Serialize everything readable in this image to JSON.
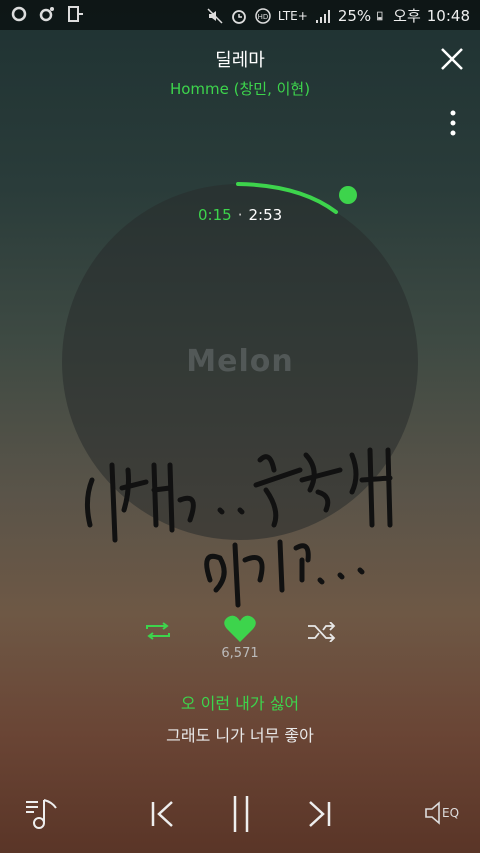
{
  "status_bar": {
    "battery": "25%",
    "ampm": "오후",
    "time": "10:48",
    "network": "LTE+"
  },
  "track": {
    "title": "딜레마",
    "artist": "Homme (창민, 이현)",
    "current_time": "0:15",
    "total_time": "2:53",
    "progress": 0.087
  },
  "album": {
    "logo": "Melon"
  },
  "actions": {
    "like_count": "6,571"
  },
  "lyrics": {
    "current": "오 이런 내가 싫어",
    "next": "그래도 니가 너무 좋아"
  },
  "player": {
    "eq_label": "EQ"
  },
  "colors": {
    "accent": "#3dd44c"
  },
  "icons": [
    "close-icon",
    "more-vert-icon",
    "repeat-icon",
    "heart-icon",
    "shuffle-icon",
    "playlist-icon",
    "previous-icon",
    "pause-icon",
    "next-icon",
    "eq-icon"
  ]
}
